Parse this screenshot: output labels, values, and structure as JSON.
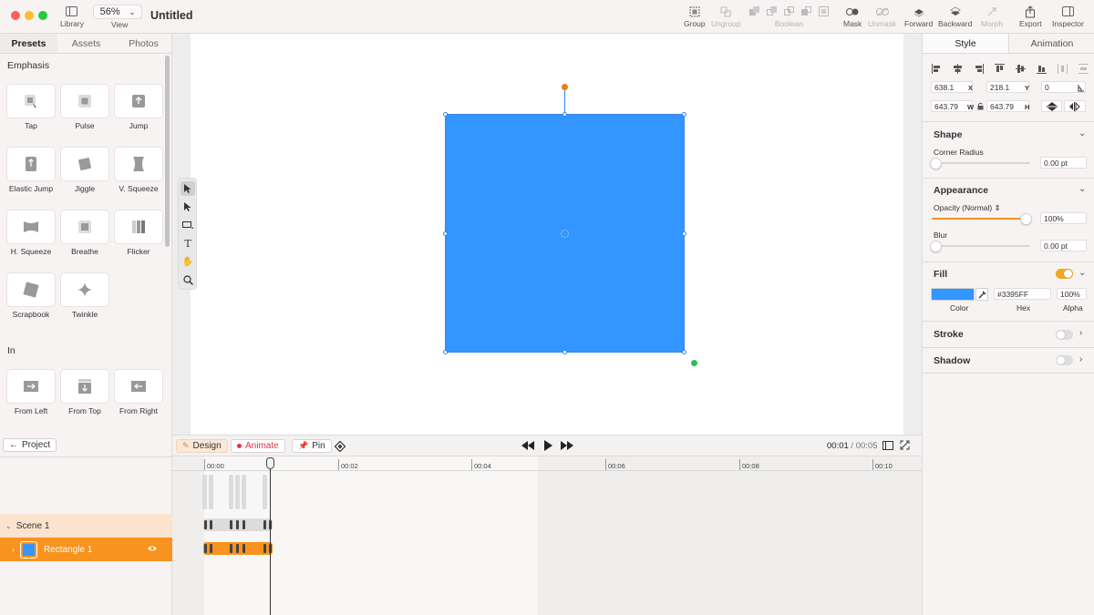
{
  "window": {
    "title": "Untitled",
    "zoom": "56%"
  },
  "toolbar": {
    "library": "Library",
    "view": "View",
    "group": "Group",
    "ungroup": "Ungroup",
    "boolean": "Boolean",
    "mask": "Mask",
    "unmask": "Unmask",
    "forward": "Forward",
    "backward": "Backward",
    "morph": "Morph",
    "export": "Export",
    "inspector": "Inspector"
  },
  "left_panel": {
    "tabs": [
      "Presets",
      "Assets",
      "Photos"
    ],
    "active_tab": "Presets",
    "emphasis_title": "Emphasis",
    "emphasis": [
      "Tap",
      "Pulse",
      "Jump",
      "Elastic Jump",
      "Jiggle",
      "V. Squeeze",
      "H. Squeeze",
      "Breathe",
      "Flicker",
      "Scrapbook",
      "Twinkle"
    ],
    "in_title": "In",
    "in": [
      "From Left",
      "From Top",
      "From Right"
    ]
  },
  "layers": {
    "project_label": "Project",
    "scene": "Scene 1",
    "layer": "Rectangle 1"
  },
  "timeline": {
    "design_label": "Design",
    "animate_label": "Animate",
    "pin_label": "Pin",
    "current_time": "00:01",
    "separator": "/",
    "total_time": "00:05",
    "ruler_labels": [
      "00:00",
      "00:02",
      "00:04",
      "00:06",
      "00:08",
      "00:10"
    ]
  },
  "inspector": {
    "tabs": [
      "Style",
      "Animation"
    ],
    "active_tab": "Style",
    "x": "638.1",
    "x_label": "X",
    "y": "218.1",
    "y_label": "Y",
    "rotation": "0",
    "w": "643.79",
    "w_label": "W",
    "h": "643.79",
    "h_label": "H",
    "shape_title": "Shape",
    "corner_radius_label": "Corner Radius",
    "corner_radius_value": "0.00 pt",
    "appearance_title": "Appearance",
    "opacity_label": "Opacity (Normal)",
    "opacity_value": "100%",
    "opacity_level": 1.0,
    "blur_label": "Blur",
    "blur_value": "0.00 pt",
    "fill_title": "Fill",
    "fill_enabled": true,
    "fill_color": "#3395FF",
    "fill_hex": "#3395FF",
    "fill_alpha": "100%",
    "color_caption": "Color",
    "hex_caption": "Hex",
    "alpha_caption": "Alpha",
    "stroke_title": "Stroke",
    "stroke_enabled": false,
    "shadow_title": "Shadow",
    "shadow_enabled": false
  },
  "colors": {
    "accent": "#F7931E",
    "shape_fill": "#3395FF",
    "animate_red": "#E7304B"
  }
}
